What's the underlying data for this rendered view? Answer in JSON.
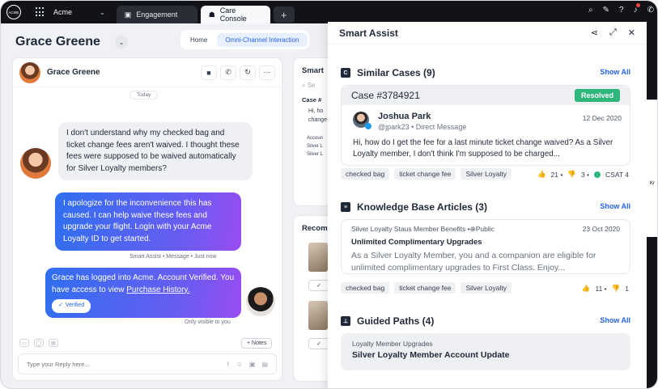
{
  "topbar": {
    "logo_text": "ACME",
    "org_name": "Acme",
    "tabs": [
      {
        "label": "Engagement"
      },
      {
        "label": "Care Console"
      }
    ]
  },
  "customer": {
    "name": "Grace Greene",
    "subtabs": [
      "Home",
      "Omni-Channel Interaction"
    ]
  },
  "chat": {
    "header_name": "Grace Greene",
    "date_divider": "Today",
    "incoming_message": "I don't understand why my checked bag and ticket change fees aren't waived. I thought these fees were supposed to be waived automatically for Silver Loyalty members?",
    "outgoing_message": "I apologize for the inconvenience this has caused. I can help waive these fees and upgrade your flight. Login with your Acme Loyalty ID to get started.",
    "outgoing_meta": "Smart Assist • Message • Just now",
    "system_message_prefix": "Grace has logged into Acme. Account Verified. You have access to view ",
    "system_message_link": "Purchase History.",
    "verified_badge": "Verified",
    "visibility_note": "Only visible to you",
    "notes_button": "+ Notes",
    "reply_placeholder": "Type your Reply here..."
  },
  "middle": {
    "top_title": "Smart",
    "search_fragment": "Se",
    "case_fragment": "Case #",
    "text_fragment": "Hi, ho\nchange",
    "account_fragment": "Accoun\nSilver L\nSilver L",
    "bottom_title": "Recom"
  },
  "assist": {
    "title": "Smart Assist",
    "similar_cases": {
      "title": "Similar Cases (9)",
      "show_all": "Show All",
      "case_number": "Case #3784921",
      "status": "Resolved",
      "author": "Joshua Park",
      "handle": "@jpark23 • Direct Message",
      "date": "12 Dec 2020",
      "text": "Hi, how do I get the fee for a last minute ticket change waived? As a Silver Loyalty member, I don't think I'm supposed to be charged...",
      "tags": [
        "checked bag",
        "ticket change fee",
        "Silver Loyalty"
      ],
      "likes": "21 •",
      "dislikes": "3 •",
      "csat": "CSAT 4"
    },
    "knowledge_base": {
      "title": "Knowledge Base Articles (3)",
      "show_all": "Show All",
      "meta": "Silver Loyalty Staus Member Benefits • ",
      "visibility": "Public",
      "date": "23 Oct 2020",
      "article_title": "Unlimited Complimentary Upgrades",
      "text": "As a Silver Loyalty Member, you and a companion are eligible for unlimited complimentary upgrades to First Class. Enjoy...",
      "tags": [
        "checked bag",
        "ticket change fee",
        "Silver Loyalty"
      ],
      "likes": "11 •",
      "dislikes": "1"
    },
    "guided_paths": {
      "title": "Guided Paths (4)",
      "show_all": "Show All",
      "subtitle": "Loyalty Member Upgrades",
      "path_title": "Silver Loyalty Member Account Update"
    }
  },
  "edge": {
    "fragment": "Kr"
  }
}
